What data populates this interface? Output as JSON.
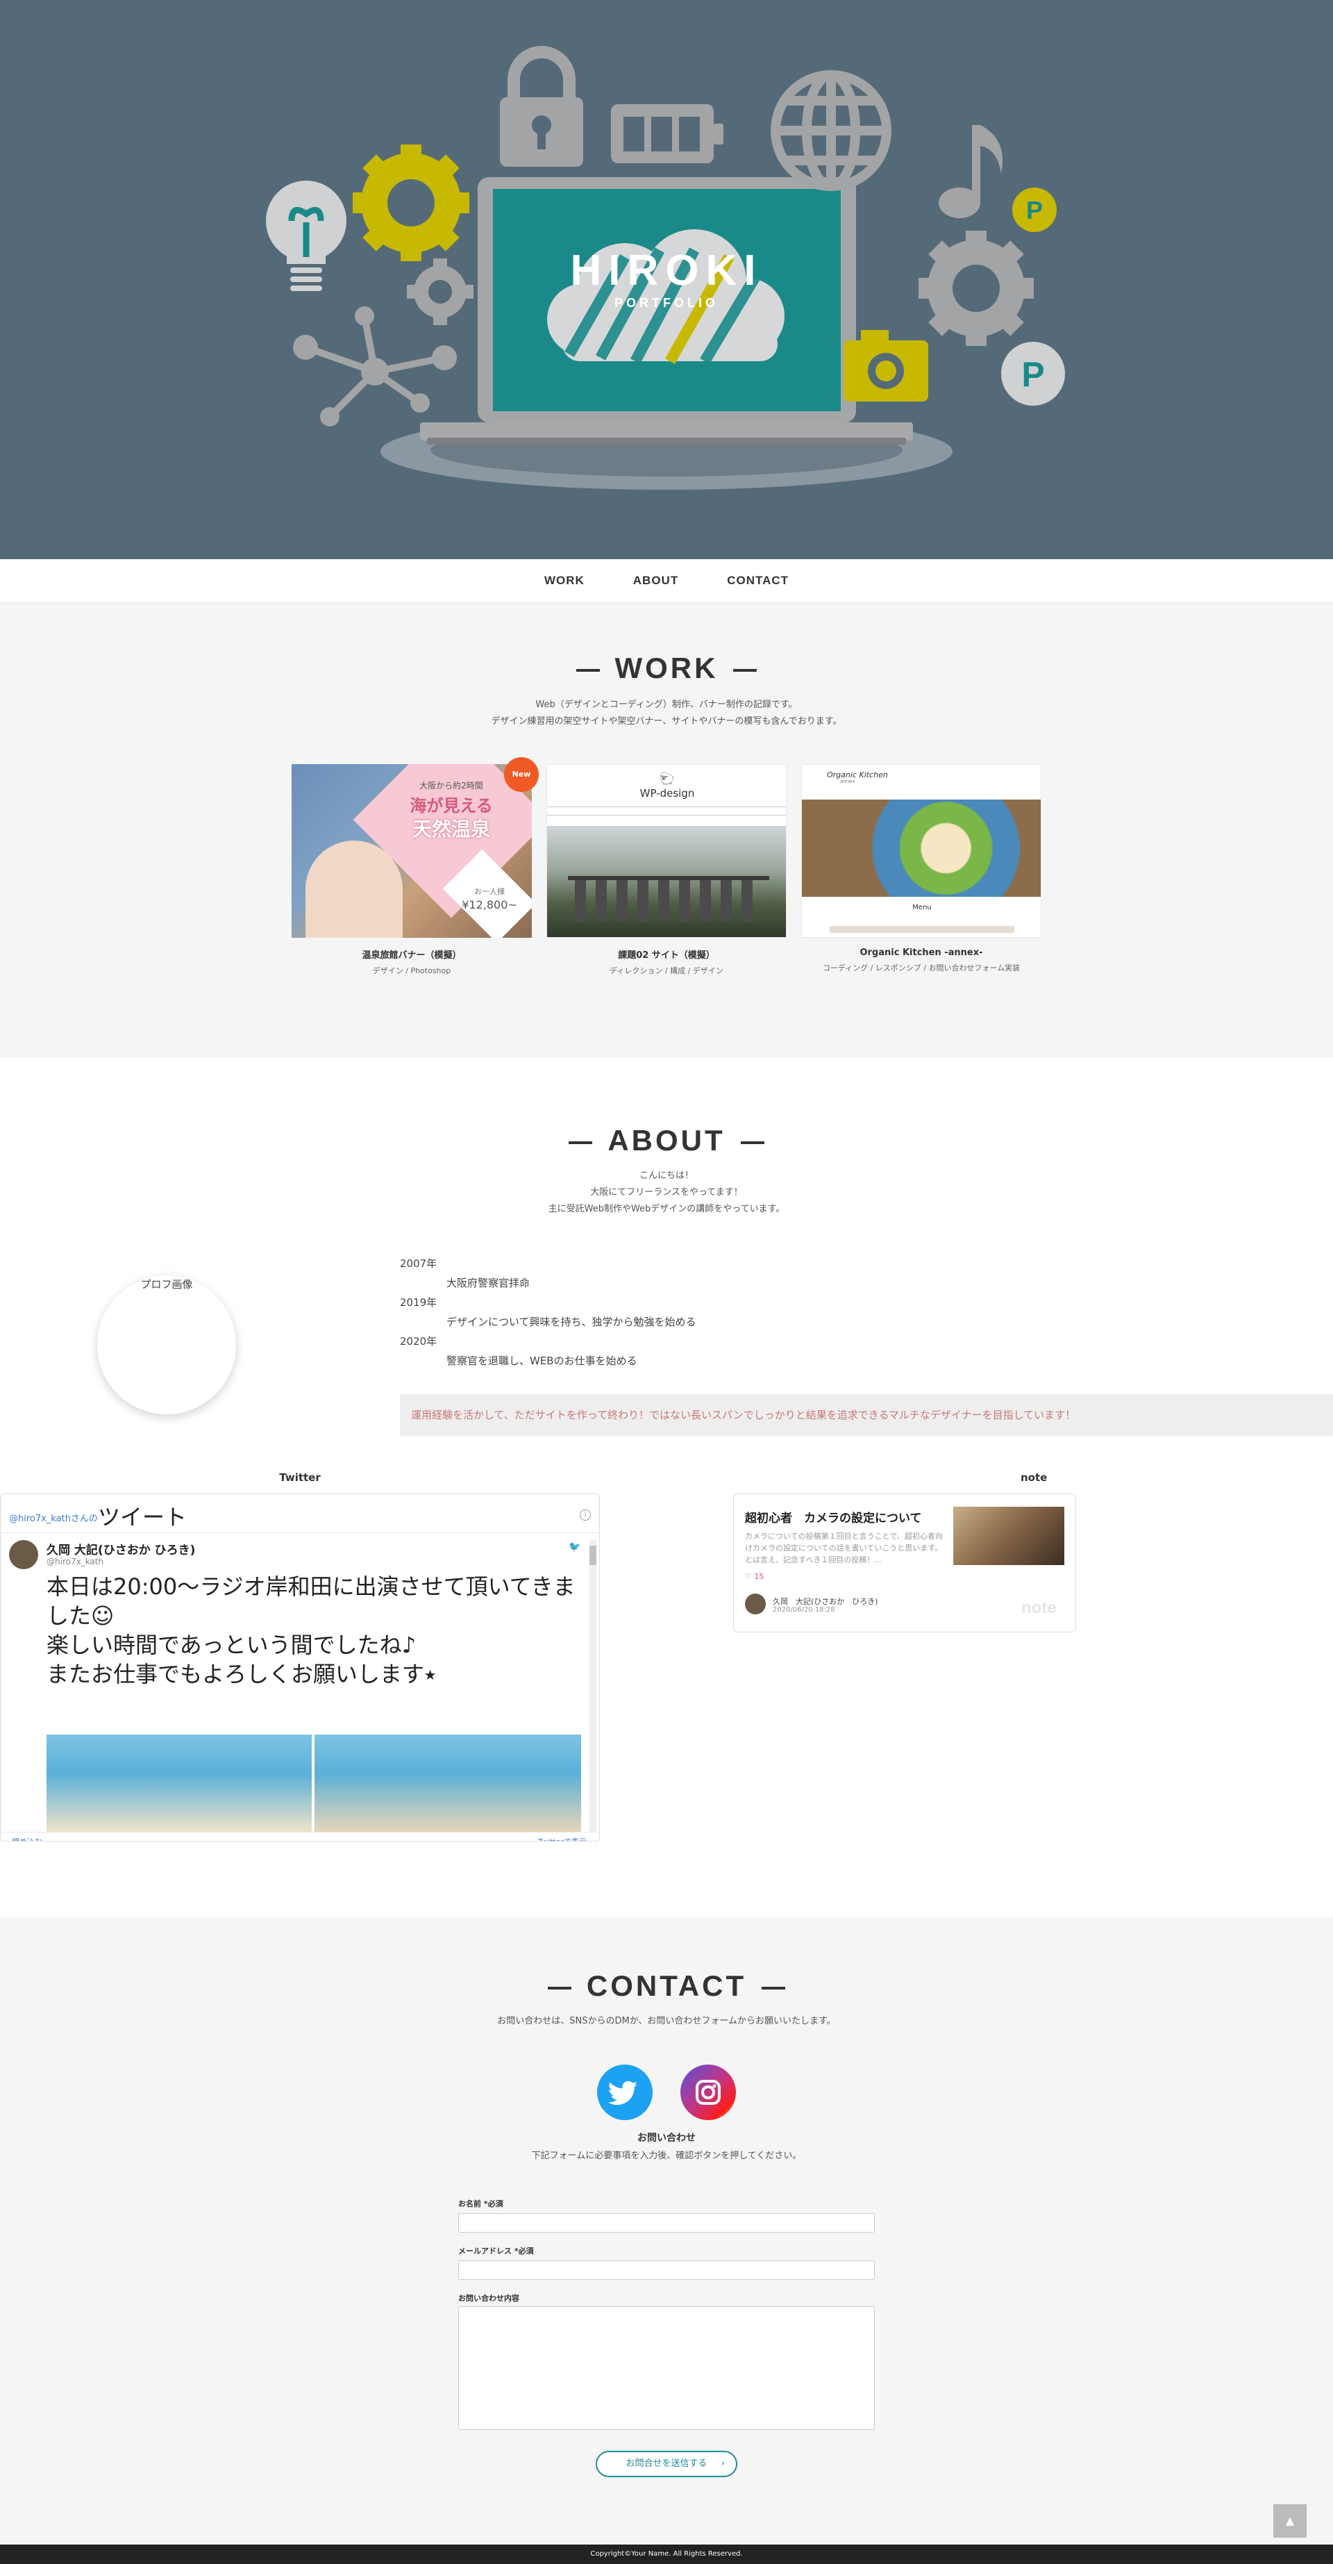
{
  "hero": {
    "logo_main": "HIROKI",
    "logo_sub": "PORTFOLIO"
  },
  "nav": {
    "items": [
      "WORK",
      "ABOUT",
      "CONTACT"
    ]
  },
  "work": {
    "title": "WORK",
    "desc_line1": "Web（デザインとコーディング）制作、バナー制作の記録です。",
    "desc_line2": "デザイン練習用の架空サイトや架空バナー、サイトやバナーの模写も含んでおります。",
    "items": [
      {
        "name": "温泉旅館バナー（模擬）",
        "category": "デザイン / Photoshop",
        "badge": "New",
        "thumb": {
          "line1": "大阪から約2時間",
          "line2": "海が見える",
          "line3": "天然温泉",
          "price_label": "お一人様",
          "price": "¥12,800~"
        }
      },
      {
        "name": "課題02 サイト（模擬）",
        "category": "ディレクション / 構成 / デザイン",
        "thumb": {
          "logo": "WP-design"
        }
      },
      {
        "name": "Organic Kitchen -annex-",
        "category": "コーディング / レスポンシブ / お問い合わせフォーム実装",
        "thumb": {
          "logo": "Organic Kitchen",
          "sub": "annex",
          "menu": "Menu"
        }
      }
    ]
  },
  "about": {
    "title": "ABOUT",
    "intro_line1": "こんにちは！",
    "intro_line2": "大阪にてフリーランスをやってます！",
    "intro_line3": "主に受託Web制作やWebデザインの講師をやっています。",
    "profile_label": "プロフ画像",
    "timeline": [
      {
        "year": "2007年",
        "text": "大阪府警察官拝命"
      },
      {
        "year": "2019年",
        "text": "デザインについて興味を持ち、独学から勉強を始める"
      },
      {
        "year": "2020年",
        "text": "警察官を退職し、WEBのお仕事を始める"
      }
    ],
    "banner": "運用経験を活かして、ただサイトを作って終わり！ではない長いスパンでしっかりと結果を追求できるマルチなデザイナーを目指しています！"
  },
  "twitter": {
    "label": "Twitter",
    "header_handle": "@hiro7x_kathさんの",
    "header_title": "ツイート",
    "author": "久岡 大記(ひさおか ひろき)",
    "handle": "@hiro7x_kath",
    "tweet_line1": "本日は20:00〜ラジオ岸和田に出演させて頂いてきま",
    "tweet_line2": "した☺",
    "tweet_line3": "楽しい時間であっという間でしたね♪",
    "tweet_line4": "またお仕事でもよろしくお願いします⭑",
    "embed": "埋め込む",
    "view_on": "Twitterで表示"
  },
  "note": {
    "label": "note",
    "title": "超初心者　カメラの設定について",
    "excerpt": "カメラについての投稿第１回目と言うことで、超初心者向けカメラの設定についての話を書いていこうと思います。とは言え、記念すべき１回目の投稿！...",
    "likes": "15",
    "author": "久岡　大記(ひさおか　ひろき)",
    "date": "2020/06/20 18:28",
    "brand": "note"
  },
  "contact": {
    "title": "CONTACT",
    "desc": "お問い合わせは、SNSからのDMか、お問い合わせフォームからお願いいたします。",
    "form_title": "お問い合わせ",
    "form_desc": "下記フォームに必要事項を入力後、確認ボタンを押してください。",
    "name_label": "お名前 *必須",
    "email_label": "メールアドレス *必須",
    "message_label": "お問い合わせ内容",
    "submit": "お問合せを送信する",
    "submit_arrow": "›",
    "twitter_color": "#1da1f2",
    "instagram_color": "#d6317f"
  },
  "footer": {
    "copyright": "Copyright©Your Name. All Rights Reserved."
  },
  "totop": "▲"
}
